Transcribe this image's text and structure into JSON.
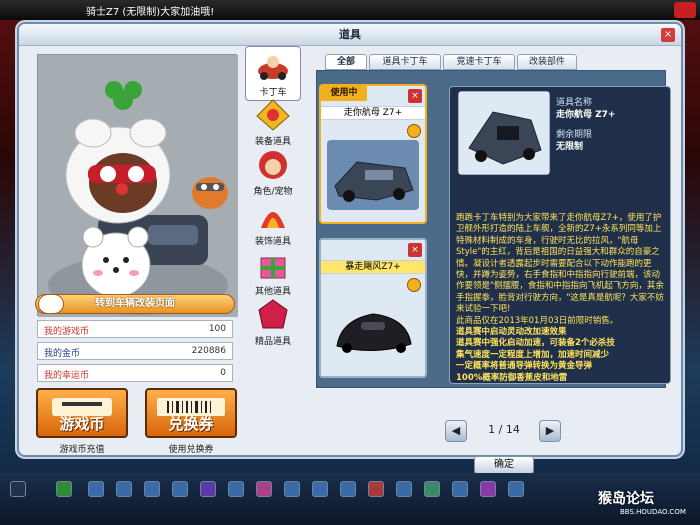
{
  "topbar": {
    "notice": "骑士Z7 (无限制)大家加油哦!"
  },
  "window": {
    "title": "道具",
    "close": "×"
  },
  "avatar": {
    "change_page_label": "转到车辆改装页面"
  },
  "stats": [
    {
      "label": "我的游戏币",
      "value": "100",
      "color": "#d0342c"
    },
    {
      "label": "我的金币",
      "value": "220886",
      "color": "#1f3fa4"
    },
    {
      "label": "我的幸运币",
      "value": "0",
      "color": "#d0342c"
    }
  ],
  "big_buttons": [
    {
      "label": "游戏币",
      "caption": "游戏币充值"
    },
    {
      "label": "兑换券",
      "caption": "使用兑换券"
    }
  ],
  "categories": [
    {
      "label": "卡丁车",
      "icon": "kart-icon"
    },
    {
      "label": "装备道具",
      "icon": "equipment-icon"
    },
    {
      "label": "角色/宠物",
      "icon": "character-icon"
    },
    {
      "label": "装饰道具",
      "icon": "decoration-icon"
    },
    {
      "label": "其他道具",
      "icon": "other-items-icon"
    },
    {
      "label": "精品道具",
      "icon": "premium-gem-icon"
    }
  ],
  "tabs": [
    "全部",
    "道具卡丁车",
    "竞速卡丁车",
    "改装部件"
  ],
  "items": [
    {
      "tag": "使用中",
      "name": "走你航母 Z7+"
    },
    {
      "tag": "",
      "name": "暴走飓风Z7+"
    }
  ],
  "detail": {
    "name_label": "道具名称",
    "name_value": "走你航母 Z7+",
    "expiry_label": "剩余期限",
    "expiry_value": "无限制",
    "description": [
      "跑跑卡丁车特别为大家带来了走你航母Z7+，使用了护卫舰外形打造的陆上车舰，全新的Z7+永系列同等加上特殊材料制成的车身，行驶时无比的拉风，\"航母Style\"的主红，背后是祖国的日益强大和群众的自豪之情。凝设计者透露起步时需要配合以下动作能跑的更快，并蹲为姿势，右手食指和中指指向行驶前端，该动作要领是\"侧摆腰，食指和中指指向飞机起飞方向，其余手指握拳，脸背对行驶方向，\"这是真是航呢？大家不妨来试验一下吧!",
      "此商品仅在2013年01月03日前限时销售。",
      "道具赛中启动灵动改加速效果",
      "道具赛中强化启动加速，可装备2个必杀技",
      "集气速度一定程度上增加，加速时间减少",
      "一定概率将普通导弹转换为黄金导弹",
      "100%概率防御香蕉皮和地雷"
    ]
  },
  "pager": {
    "current": "1",
    "sep": "/",
    "total": "14",
    "prev": "◀",
    "next": "▶"
  },
  "ok_label": "确定",
  "watermark": {
    "name": "猴岛论坛",
    "url": "BBS.HOUDAO.COM"
  }
}
